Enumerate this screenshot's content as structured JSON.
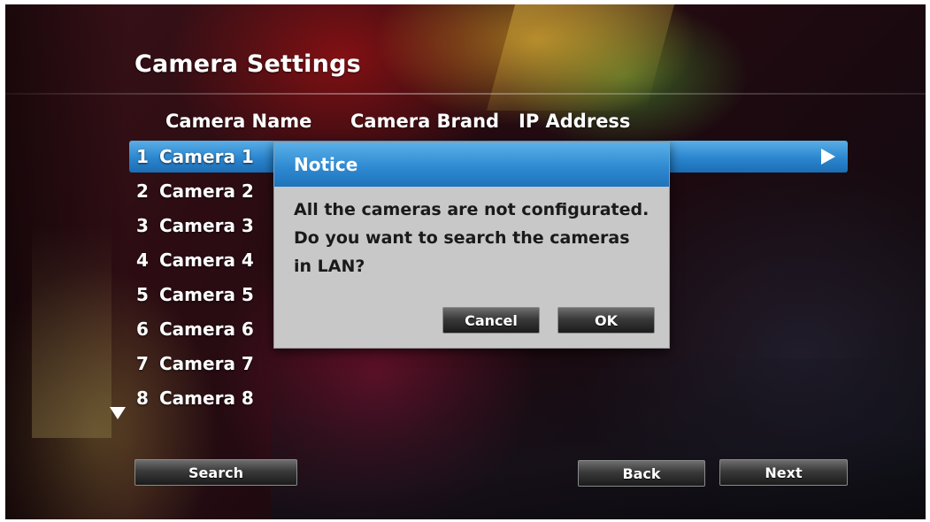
{
  "header": {
    "title": "Camera Settings"
  },
  "columns": {
    "camera_name": "Camera Name",
    "camera_brand": "Camera Brand",
    "ip_address": "IP Address"
  },
  "cameras": [
    {
      "index": "1",
      "name": "Camera 1",
      "selected": true
    },
    {
      "index": "2",
      "name": "Camera 2",
      "selected": false
    },
    {
      "index": "3",
      "name": "Camera 3",
      "selected": false
    },
    {
      "index": "4",
      "name": "Camera 4",
      "selected": false
    },
    {
      "index": "5",
      "name": "Camera 5",
      "selected": false
    },
    {
      "index": "6",
      "name": "Camera 6",
      "selected": false
    },
    {
      "index": "7",
      "name": "Camera 7",
      "selected": false
    },
    {
      "index": "8",
      "name": "Camera 8",
      "selected": false
    }
  ],
  "dialog": {
    "title": "Notice",
    "message_lines": [
      "All the cameras are not configurated.",
      "Do you want to search the cameras",
      "in LAN?"
    ],
    "cancel_label": "Cancel",
    "ok_label": "OK"
  },
  "footer": {
    "search_label": "Search",
    "back_label": "Back",
    "next_label": "Next"
  },
  "icons": {
    "row_arrow": "triangle-right-icon",
    "scroll_down": "triangle-down-icon"
  },
  "colors": {
    "selection": "#2b86cf",
    "dialog_header": "#2f8ad2",
    "dialog_body": "#c8c8c8"
  }
}
